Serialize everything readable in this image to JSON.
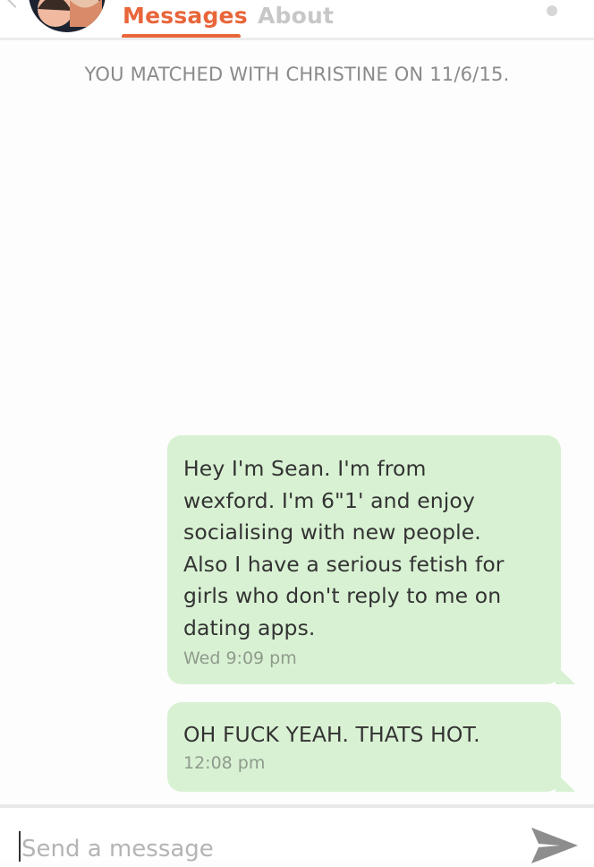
{
  "header": {
    "tabs": [
      {
        "label": "Messages",
        "active": true
      },
      {
        "label": "About",
        "active": false
      }
    ]
  },
  "conversation": {
    "match_notice": "YOU MATCHED WITH CHRISTINE ON 11/6/15.",
    "messages": [
      {
        "text": "Hey I'm Sean. I'm from\nwexford. I'm 6\"1' and enjoy\nsocialising with new people.\nAlso I have a serious fetish for\ngirls who don't reply to me on\ndating apps.",
        "time": "Wed  9:09 pm"
      },
      {
        "text": "OH FUCK YEAH. THATS HOT.",
        "time": "12:08 pm"
      }
    ]
  },
  "composer": {
    "placeholder": "Send a message"
  },
  "colors": {
    "accent": "#e8663a",
    "bubble": "#d8f1d3",
    "inactive_tab": "#c7c7c7"
  },
  "icons": {
    "back": "chevron-left-icon",
    "menu": "dot-icon",
    "send": "send-arrow-icon"
  }
}
